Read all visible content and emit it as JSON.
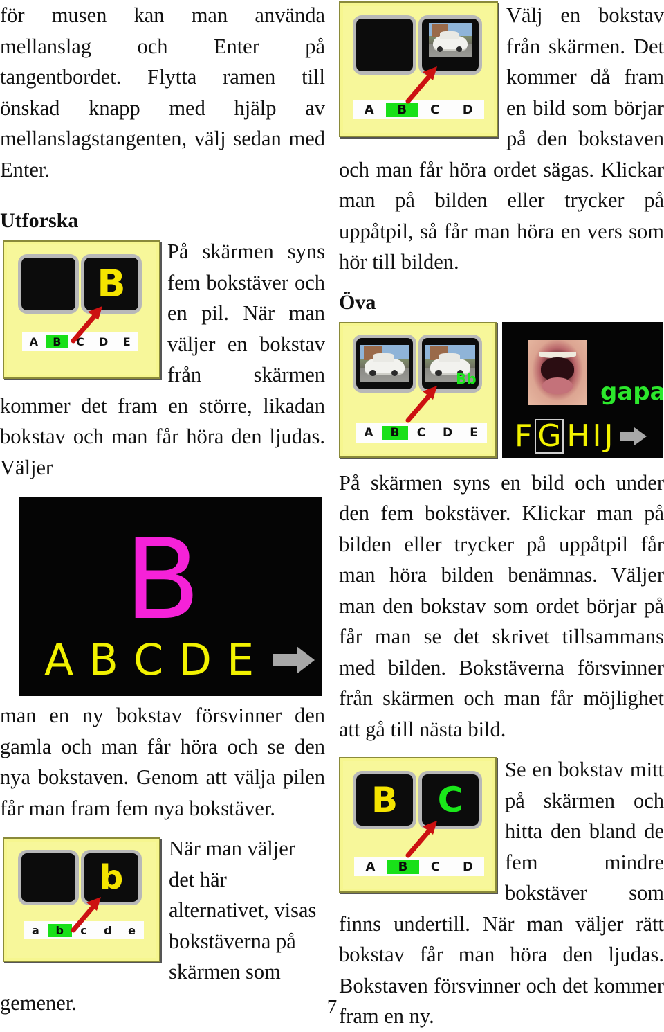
{
  "page": {
    "number": "7",
    "language": "sv"
  },
  "left_column": {
    "intro_paragraph": "för musen kan man använda mellanslag och Enter på tangentbordet. Flytta ramen till önskad knapp med hjälp av mellanslagstangenten, välj sedan med Enter.",
    "heading_utforska": "Utforska",
    "paragraph_1": "På skärmen syns fem bokstäver och en pil. När man väljer en bokstav från skärmen kommer det fram en större, likadan bokstav och man får höra den ljudas. Väljer",
    "paragraph_2": "man en ny bokstav försvinner den gamla och man får höra och se den nya bokstaven. Genom att välja pilen får man fram fem nya bokstäver.",
    "paragraph_3": "När man väljer det här alternativet, visas bokstäverna på skärmen som gemener."
  },
  "right_column": {
    "paragraph_1": "Välj en bokstav från skärmen. Det kommer då fram en bild som börjar på den bokstaven och man får höra ordet sägas. Klickar man på bilden eller trycker på uppåtpil, så får man höra en vers som hör till bilden.",
    "heading_ova": "Öva",
    "paragraph_2": "På skärmen syns en bild och under den fem bokstäver. Klickar man på bilden eller trycker på uppåtpil får man höra bilden benämnas. Väljer man den bokstav som ordet börjar på får man se det skrivet tillsammans med bilden. Bokstäverna försvinner från skärmen och man får möjlighet att gå till nästa bild.",
    "paragraph_3": "Se en bokstav mitt på skärmen och hitta den bland de fem mindre bokstäver som finns undertill. När man väljer rätt bokstav får man höra den ljudas. Bokstaven försvinner och det kommer fram en ny."
  },
  "figures": {
    "fig_utforska_upper": {
      "caption_name": "app-window-letter-B-uppercase",
      "pane_left_content": "",
      "pane_right_letter": "B",
      "pane_right_letter_color": "#f5e400",
      "strip_letters": [
        "A",
        "B",
        "C",
        "D",
        "E"
      ],
      "strip_selected": "B",
      "background_color": "#f7f79a",
      "cursor": "red-arrow"
    },
    "fig_big_screen_B": {
      "caption_name": "fullscreen-letter-B",
      "big_letter": "B",
      "big_letter_color": "#f522d8",
      "row_letters": [
        "A",
        "B",
        "C",
        "D",
        "E"
      ],
      "row_letters_color": "#f2f200",
      "next_arrow": "gray-right-arrow",
      "background_color": "#050505"
    },
    "fig_utforska_lower": {
      "caption_name": "app-window-letter-b-lowercase",
      "pane_left_content": "",
      "pane_right_letter": "b",
      "pane_right_letter_color": "#f5e400",
      "strip_letters": [
        "a",
        "b",
        "c",
        "d",
        "e"
      ],
      "strip_selected": "b",
      "background_color": "#f7f79a",
      "cursor": "red-arrow"
    },
    "fig_picture_word": {
      "caption_name": "app-window-car-picture",
      "pane_left_content": "",
      "pane_right_content": "car-photo",
      "strip_letters": [
        "A",
        "B",
        "C",
        "D"
      ],
      "strip_selected": "B",
      "background_color": "#f7f79a",
      "cursor": "red-arrow"
    },
    "fig_ova_car": {
      "caption_name": "app-window-car-picture-Bb",
      "pane_left_content": "car-photo",
      "pane_right_content": "car-photo",
      "pane_right_tag": "Bb",
      "pane_right_tag_color": "#1ae81a",
      "strip_letters": [
        "A",
        "B",
        "C",
        "D",
        "E"
      ],
      "strip_selected": "B",
      "background_color": "#f7f79a",
      "cursor": "red-arrow"
    },
    "fig_gapa": {
      "caption_name": "fullscreen-mouth-gapa",
      "word": "gapa",
      "word_color": "#2ce82c",
      "row_letters": [
        "F",
        "G",
        "H",
        "I",
        "J"
      ],
      "row_selected": "G",
      "row_letters_color": "#f2f200",
      "next_arrow": "gray-right-arrow",
      "background_color": "#050505"
    },
    "fig_BC": {
      "caption_name": "app-window-letters-B-C",
      "pane_left_letter": "B",
      "pane_left_letter_color": "#f5e400",
      "pane_right_letter": "C",
      "pane_right_letter_color": "#1ae81a",
      "strip_letters": [
        "A",
        "B",
        "C",
        "D"
      ],
      "strip_selected": "B",
      "background_color": "#f7f79a",
      "cursor": "red-arrow"
    }
  }
}
